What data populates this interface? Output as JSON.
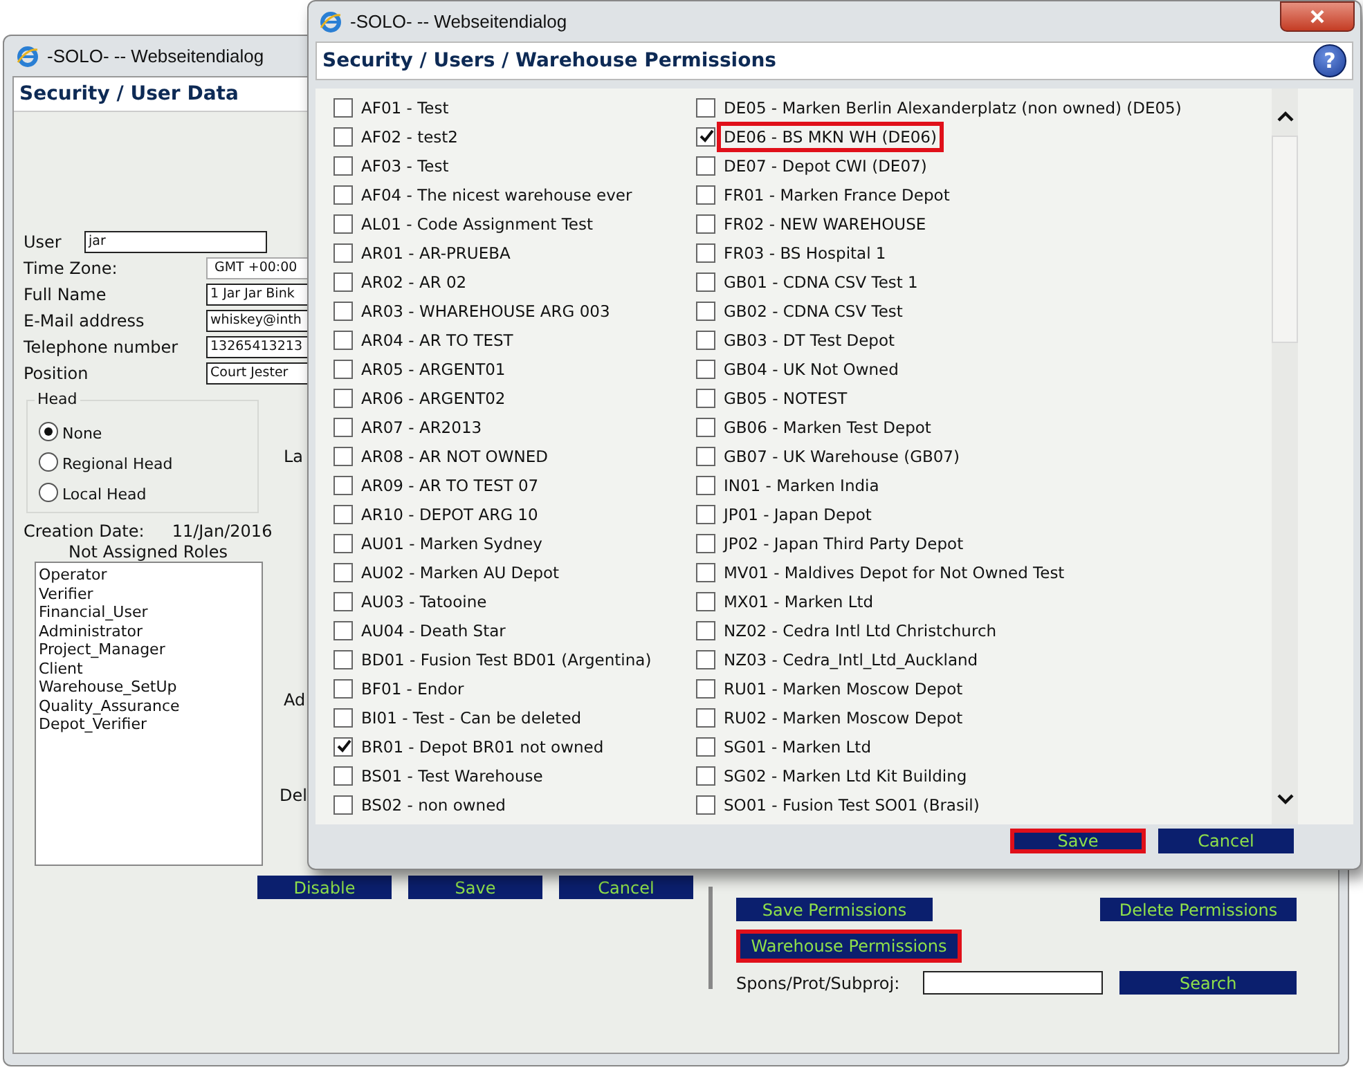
{
  "background_window": {
    "title": "-SOLO- -- Webseitendialog",
    "heading": "Security / User Data",
    "fields": [
      {
        "label": "User",
        "value": "jar",
        "kind": "wide"
      },
      {
        "label": "Time Zone:",
        "value": "GMT +00:00",
        "kind": "select"
      },
      {
        "label": "Full Name",
        "value": "1 Jar Jar Bink",
        "kind": "input"
      },
      {
        "label": "E-Mail address",
        "value": "whiskey@inth",
        "kind": "input"
      },
      {
        "label": "Telephone number",
        "value": "13265413213",
        "kind": "input"
      },
      {
        "label": "Position",
        "value": "Court Jester",
        "kind": "input"
      }
    ],
    "head_group": {
      "legend": "Head",
      "options": [
        {
          "label": "None",
          "selected": true
        },
        {
          "label": "Regional Head",
          "selected": false
        },
        {
          "label": "Local Head",
          "selected": false
        }
      ]
    },
    "cut_labels": [
      "La",
      "Ad",
      "Del"
    ],
    "creation_date": {
      "label": "Creation Date:",
      "value": "11/Jan/2016"
    },
    "roles": {
      "title": "Not Assigned Roles",
      "items": [
        "Operator",
        "Verifier",
        "Financial_User",
        "Administrator",
        "Project_Manager",
        "Client",
        "Warehouse_SetUp",
        "Quality_Assurance",
        "Depot_Verifier"
      ]
    },
    "buttons": [
      "Disable",
      "Save",
      "Cancel"
    ],
    "permissions": {
      "save": "Save Permissions",
      "delete": "Delete Permissions",
      "warehouse": {
        "label": "Warehouse Permissions",
        "highlighted": true
      },
      "search_label": "Spons/Prot/Subproj:",
      "search_button": "Search"
    }
  },
  "dialog": {
    "title": "-SOLO- -- Webseitendialog",
    "heading": "Security / Users / Warehouse Permissions",
    "help": "?",
    "warehouses": [
      {
        "label": "AF01 - Test",
        "checked": false,
        "highlighted": false
      },
      {
        "label": "AF02 - test2",
        "checked": false,
        "highlighted": false
      },
      {
        "label": "AF03 - Test",
        "checked": false,
        "highlighted": false
      },
      {
        "label": "AF04 - The nicest warehouse ever",
        "checked": false,
        "highlighted": false
      },
      {
        "label": "AL01 - Code Assignment Test",
        "checked": false,
        "highlighted": false
      },
      {
        "label": "AR01 - AR-PRUEBA",
        "checked": false,
        "highlighted": false
      },
      {
        "label": "AR02 - AR 02",
        "checked": false,
        "highlighted": false
      },
      {
        "label": "AR03 - WHAREHOUSE ARG 003",
        "checked": false,
        "highlighted": false
      },
      {
        "label": "AR04 - AR TO TEST",
        "checked": false,
        "highlighted": false
      },
      {
        "label": "AR05 - ARGENT01",
        "checked": false,
        "highlighted": false
      },
      {
        "label": "AR06 - ARGENT02",
        "checked": false,
        "highlighted": false
      },
      {
        "label": "AR07 - AR2013",
        "checked": false,
        "highlighted": false
      },
      {
        "label": "AR08 - AR NOT OWNED",
        "checked": false,
        "highlighted": false
      },
      {
        "label": "AR09 - AR TO TEST 07",
        "checked": false,
        "highlighted": false
      },
      {
        "label": "AR10 - DEPOT ARG 10",
        "checked": false,
        "highlighted": false
      },
      {
        "label": "AU01 - Marken Sydney",
        "checked": false,
        "highlighted": false
      },
      {
        "label": "AU02 - Marken AU Depot",
        "checked": false,
        "highlighted": false
      },
      {
        "label": "AU03 - Tatooine",
        "checked": false,
        "highlighted": false
      },
      {
        "label": "AU04 - Death Star",
        "checked": false,
        "highlighted": false
      },
      {
        "label": "BD01 - Fusion Test BD01 (Argentina)",
        "checked": false,
        "highlighted": false
      },
      {
        "label": "BF01 - Endor",
        "checked": false,
        "highlighted": false
      },
      {
        "label": "BI01 - Test - Can be deleted",
        "checked": false,
        "highlighted": false
      },
      {
        "label": "BR01 - Depot BR01 not owned",
        "checked": true,
        "highlighted": false
      },
      {
        "label": "BS01 - Test Warehouse",
        "checked": false,
        "highlighted": false
      },
      {
        "label": "BS02 - non owned",
        "checked": false,
        "highlighted": false
      },
      {
        "label": "DE05 - Marken Berlin Alexanderplatz (non owned) (DE05)",
        "checked": false,
        "highlighted": false
      },
      {
        "label": "DE06 - BS MKN WH (DE06)",
        "checked": true,
        "highlighted": true
      },
      {
        "label": "DE07 - Depot CWI (DE07)",
        "checked": false,
        "highlighted": false
      },
      {
        "label": "FR01 - Marken France Depot",
        "checked": false,
        "highlighted": false
      },
      {
        "label": "FR02 - NEW WAREHOUSE",
        "checked": false,
        "highlighted": false
      },
      {
        "label": "FR03 - BS Hospital 1",
        "checked": false,
        "highlighted": false
      },
      {
        "label": "GB01 - CDNA CSV Test 1",
        "checked": false,
        "highlighted": false
      },
      {
        "label": "GB02 - CDNA CSV Test",
        "checked": false,
        "highlighted": false
      },
      {
        "label": "GB03 - DT Test Depot",
        "checked": false,
        "highlighted": false
      },
      {
        "label": "GB04 - UK Not Owned",
        "checked": false,
        "highlighted": false
      },
      {
        "label": "GB05 - NOTEST",
        "checked": false,
        "highlighted": false
      },
      {
        "label": "GB06 - Marken Test Depot",
        "checked": false,
        "highlighted": false
      },
      {
        "label": "GB07 - UK Warehouse (GB07)",
        "checked": false,
        "highlighted": false
      },
      {
        "label": "IN01 - Marken India",
        "checked": false,
        "highlighted": false
      },
      {
        "label": "JP01 - Japan Depot",
        "checked": false,
        "highlighted": false
      },
      {
        "label": "JP02 - Japan Third Party Depot",
        "checked": false,
        "highlighted": false
      },
      {
        "label": "MV01 - Maldives Depot for Not Owned Test",
        "checked": false,
        "highlighted": false
      },
      {
        "label": "MX01 - Marken Ltd",
        "checked": false,
        "highlighted": false
      },
      {
        "label": "NZ02 - Cedra Intl Ltd Christchurch",
        "checked": false,
        "highlighted": false
      },
      {
        "label": "NZ03 - Cedra_Intl_Ltd_Auckland",
        "checked": false,
        "highlighted": false
      },
      {
        "label": "RU01 - Marken Moscow Depot",
        "checked": false,
        "highlighted": false
      },
      {
        "label": "RU02 - Marken Moscow Depot",
        "checked": false,
        "highlighted": false
      },
      {
        "label": "SG01 - Marken Ltd",
        "checked": false,
        "highlighted": false
      },
      {
        "label": "SG02 - Marken Ltd Kit Building",
        "checked": false,
        "highlighted": false
      },
      {
        "label": "SO01 - Fusion Test SO01 (Brasil)",
        "checked": false,
        "highlighted": false
      }
    ],
    "buttons": [
      {
        "label": "Save",
        "highlighted": true
      },
      {
        "label": "Cancel",
        "highlighted": false
      }
    ]
  }
}
